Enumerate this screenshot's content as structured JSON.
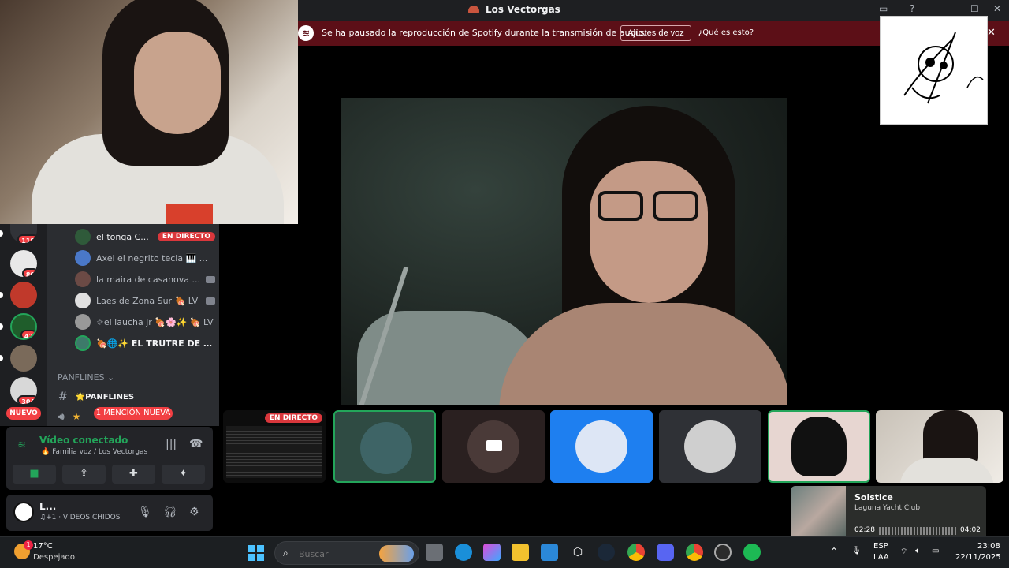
{
  "window": {
    "title": "Los Vectorgas"
  },
  "notice": {
    "message": "Se ha pausado la reproducción de Spotify durante la transmisión de audio.",
    "voice_settings_label": "Ajustes de voz",
    "what_is_this_label": "¿Qué es esto?"
  },
  "guilds": [
    {
      "badge": "118"
    },
    {
      "badge": "80"
    },
    {
      "badge": ""
    },
    {
      "badge": "42"
    },
    {
      "badge": ""
    },
    {
      "badge": "304"
    }
  ],
  "new_label": "NUEVO",
  "voice_users": [
    {
      "name": "el tonga C...",
      "live": "EN DIRECTO"
    },
    {
      "name": "Axel el negrito tecla 🎹 ..."
    },
    {
      "name": "la maira de casanova ..."
    },
    {
      "name": "Laes de Zona Sur 🍖 LV"
    },
    {
      "name": "☼el laucha jr 🍖🌸✨ 🍖 LV"
    },
    {
      "name": "🍖🌐✨ EL TRUTRE DE LA..."
    }
  ],
  "category": "PANFLINES",
  "channel_label": "🌟PANFLINES",
  "mention_label": "1 MENCIÓN NUEVA",
  "voice_panel": {
    "status": "Vídeo conectado",
    "location": "Familia voz / Los Vectorgas"
  },
  "user_panel": {
    "name": "L...",
    "activity": "♫+1 · VIDEOS CHIDOS"
  },
  "tile_live_label": "EN DIRECTO",
  "media": {
    "track": "Solstice",
    "artist": "Laguna Yacht Club",
    "elapsed": "02:28",
    "duration": "04:02",
    "progress": 0.61
  },
  "taskbar": {
    "weather_badge": "1",
    "temperature": "17°C",
    "condition": "Despejado",
    "search_placeholder": "Buscar",
    "lang_top": "ESP",
    "lang_bottom": "LAA",
    "time": "23:08",
    "date": "22/11/2025"
  },
  "colors": {
    "accent_green": "#23a55a",
    "live_red": "#da373c",
    "notice_bg": "#5c0f17"
  }
}
